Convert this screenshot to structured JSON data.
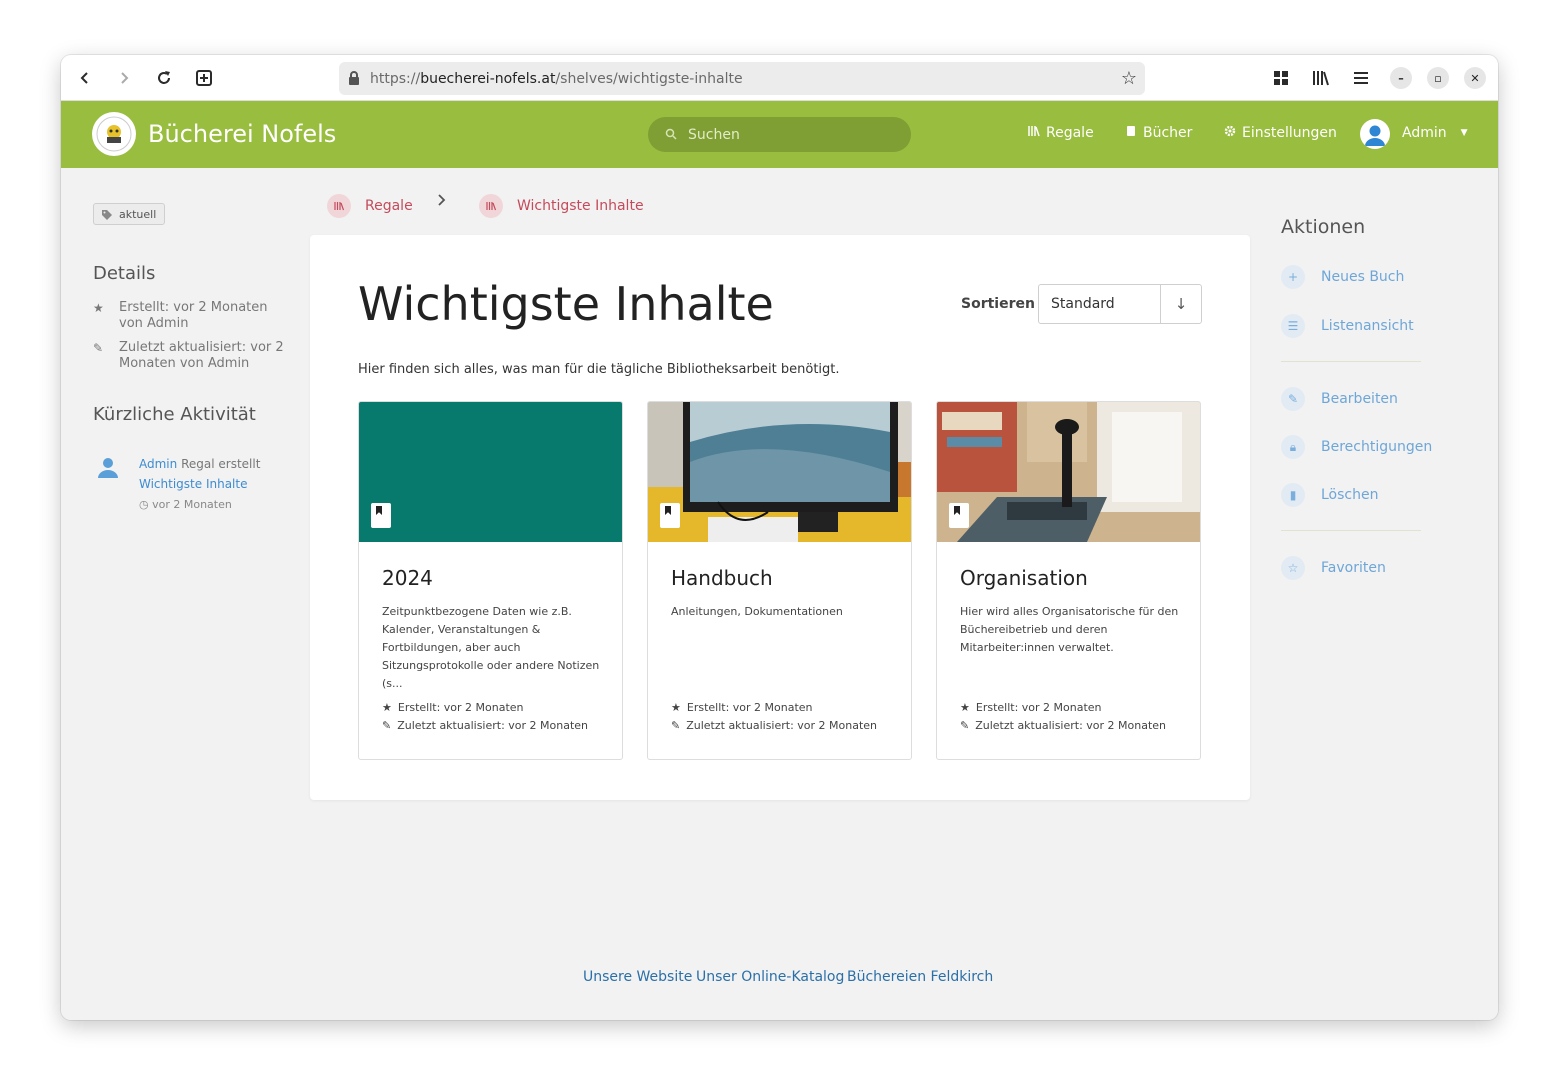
{
  "browser": {
    "url_prefix": "https://",
    "url_domain": "buecherei-nofels.at",
    "url_path": "/shelves/wichtigste-inhalte"
  },
  "header": {
    "brand": "Bücherei Nofels",
    "search_placeholder": "Suchen",
    "nav": [
      "Regale",
      "Bücher",
      "Einstellungen"
    ],
    "user": "Admin"
  },
  "left": {
    "tag": "aktuell",
    "details_title": "Details",
    "created": "Erstellt: vor 2 Monaten von Admin",
    "updated": "Zuletzt aktualisiert: vor 2 Monaten von Admin",
    "activity_title": "Kürzliche Aktivität",
    "activity_user": "Admin",
    "activity_action": "Regal erstellt",
    "activity_link": "Wichtigste Inhalte",
    "activity_time": "vor 2 Monaten"
  },
  "breadcrumb": [
    "Regale",
    "Wichtigste Inhalte"
  ],
  "main": {
    "title": "Wichtigste Inhalte",
    "sort_label": "Sortieren",
    "sort_value": "Standard",
    "description": "Hier finden sich alles, was man für die tägliche Bibliotheksarbeit benötigt."
  },
  "books": [
    {
      "title": "2024",
      "description": "Zeitpunktbezogene Daten wie z.B. Kalender, Veranstaltungen & Fortbildungen, aber auch Sitzungsprotokolle oder andere Notizen (s...",
      "created": "Erstellt: vor 2 Monaten",
      "updated": "Zuletzt aktualisiert: vor 2 Monaten",
      "cover_color": "#077a6d"
    },
    {
      "title": "Handbuch",
      "description": "Anleitungen, Dokumentationen",
      "created": "Erstellt: vor 2 Monaten",
      "updated": "Zuletzt aktualisiert: vor 2 Monaten"
    },
    {
      "title": "Organisation",
      "description": "Hier wird alles Organisatorische für den Büchereibetrieb und deren Mitarbeiter:innen verwaltet.",
      "created": "Erstellt: vor 2 Monaten",
      "updated": "Zuletzt aktualisiert: vor 2 Monaten"
    }
  ],
  "actions": {
    "title": "Aktionen",
    "items": [
      "Neues Buch",
      "Listenansicht",
      "Bearbeiten",
      "Berechtigungen",
      "Löschen",
      "Favoriten"
    ]
  },
  "footer": [
    "Unsere Website",
    "Unser Online-Katalog",
    "Büchereien Feldkirch"
  ],
  "colors": {
    "header": "#98bd3f",
    "breadcrumb": "#c44b5c",
    "action": "#6ea6d8"
  }
}
